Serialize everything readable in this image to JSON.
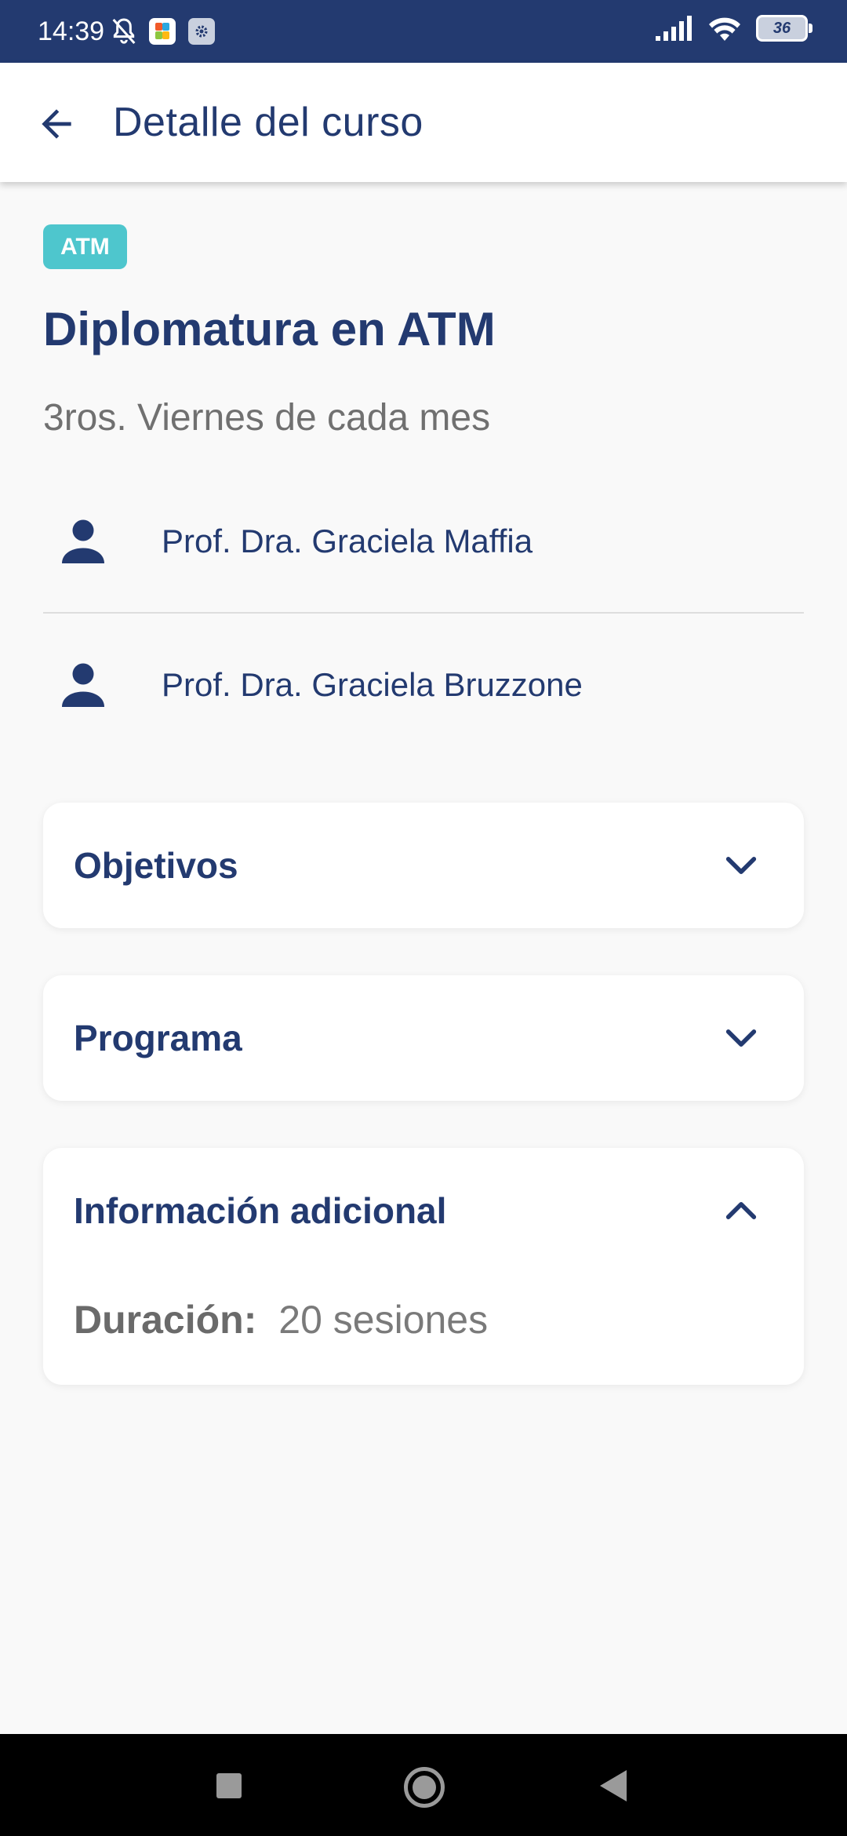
{
  "status_bar": {
    "time": "14:39",
    "battery": "36",
    "icons": [
      "bell-off-icon",
      "app-icon",
      "settings-icon",
      "signal-icon",
      "wifi-icon",
      "battery-icon"
    ]
  },
  "app_bar": {
    "title": "Detalle del curso",
    "back_icon": "arrow-left-icon"
  },
  "course": {
    "badge": "ATM",
    "title": "Diplomatura en ATM",
    "schedule": "3ros. Viernes de cada mes",
    "professors": [
      {
        "name": "Prof. Dra. Graciela Maffia",
        "icon": "person-icon"
      },
      {
        "name": "Prof. Dra. Graciela Bruzzone",
        "icon": "person-icon"
      }
    ]
  },
  "sections": [
    {
      "title": "Objetivos",
      "expanded": false
    },
    {
      "title": "Programa",
      "expanded": false
    },
    {
      "title": "Información adicional",
      "expanded": true,
      "content": {
        "label": "Duración:",
        "value": "20 sesiones"
      }
    }
  ],
  "colors": {
    "primary": "#233a70",
    "accent": "#4ec6cd",
    "background": "#f9f9f9",
    "muted_text": "#707070"
  },
  "nav_bar": {
    "icons": [
      "recents-icon",
      "home-icon",
      "back-icon"
    ]
  }
}
